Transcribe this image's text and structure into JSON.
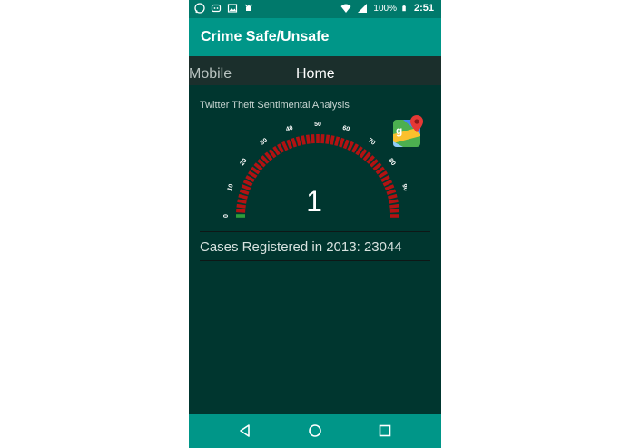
{
  "status_bar": {
    "battery": "100%",
    "time": "2:51",
    "icons": [
      "whatsapp-icon",
      "piggy-icon",
      "image-icon",
      "android-debug-icon",
      "wifi-icon",
      "signal-icon",
      "battery-icon"
    ]
  },
  "app_bar": {
    "title": "Crime Safe/Unsafe"
  },
  "tabs": [
    {
      "label": "Mobile",
      "selected": false
    },
    {
      "label": "Home",
      "selected": true
    }
  ],
  "main": {
    "subtitle": "Twitter Theft Sentimental Analysis",
    "gauge": {
      "value": "1",
      "min": 0,
      "max": 100,
      "tick_labels": [
        "0",
        "10",
        "20",
        "30",
        "40",
        "50",
        "60",
        "70",
        "80",
        "90"
      ],
      "active_color": "#2e9e3a",
      "inactive_color": "#b31212"
    },
    "cases_text": "Cases Registered in 2013: 23044"
  },
  "colors": {
    "status_bar": "#00796b",
    "app_bar": "#009688",
    "background": "#00362f",
    "tab_bar": "#1b2f2c"
  },
  "nav": {
    "icons": [
      "back-icon",
      "home-icon",
      "recent-apps-icon"
    ]
  }
}
